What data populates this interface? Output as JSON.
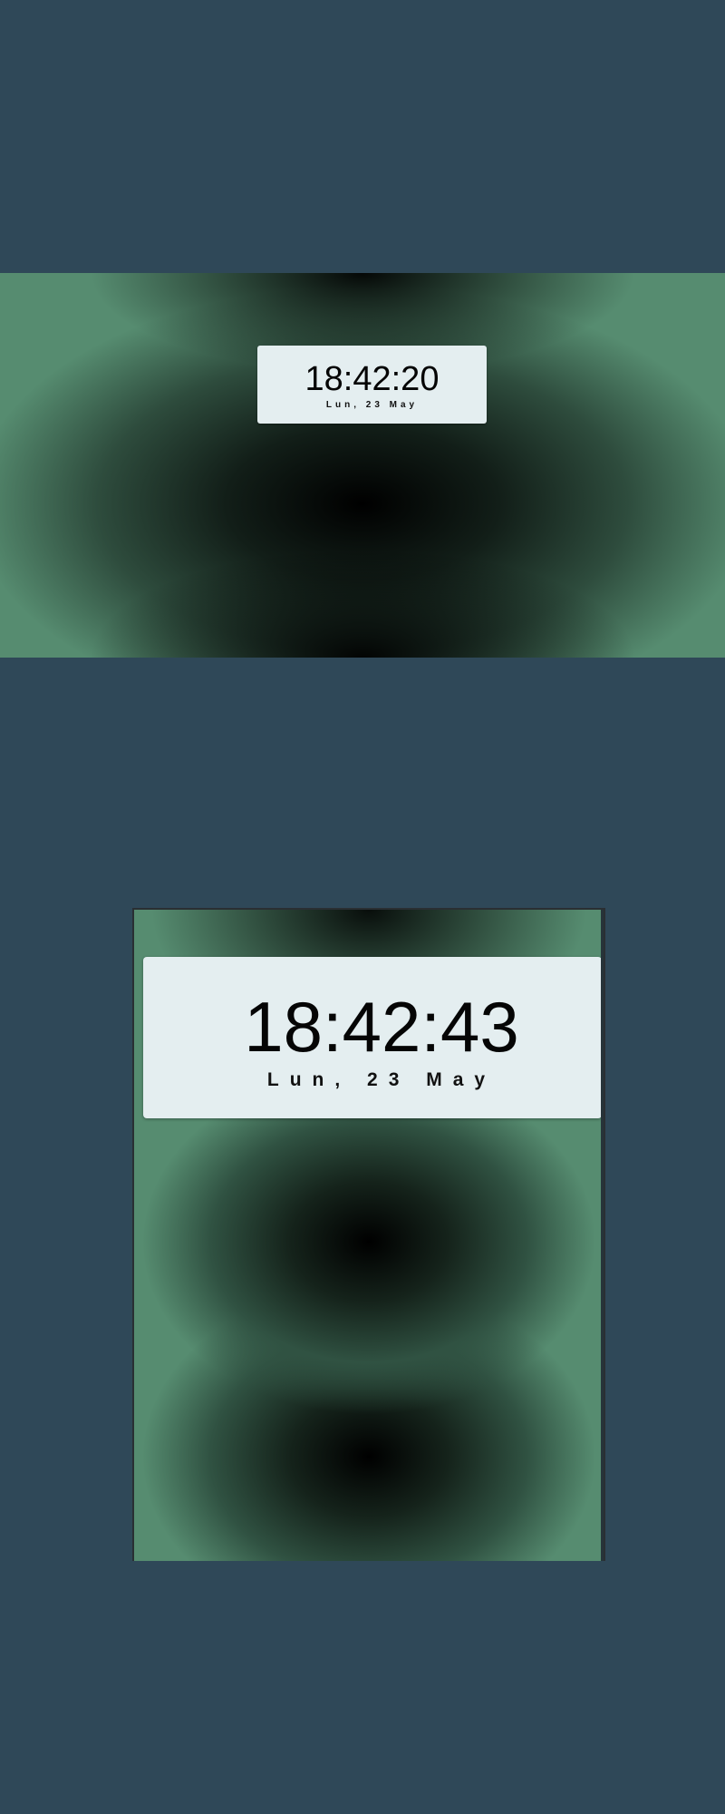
{
  "wide_preview": {
    "time": "18:42:20",
    "date": "Lun, 23 May"
  },
  "phone_preview": {
    "time": "18:42:43",
    "date": "Lun, 23 May"
  },
  "colors": {
    "page_background": "#2f4858",
    "gradient_green": "#568c70",
    "card_background": "#e4eef0"
  }
}
